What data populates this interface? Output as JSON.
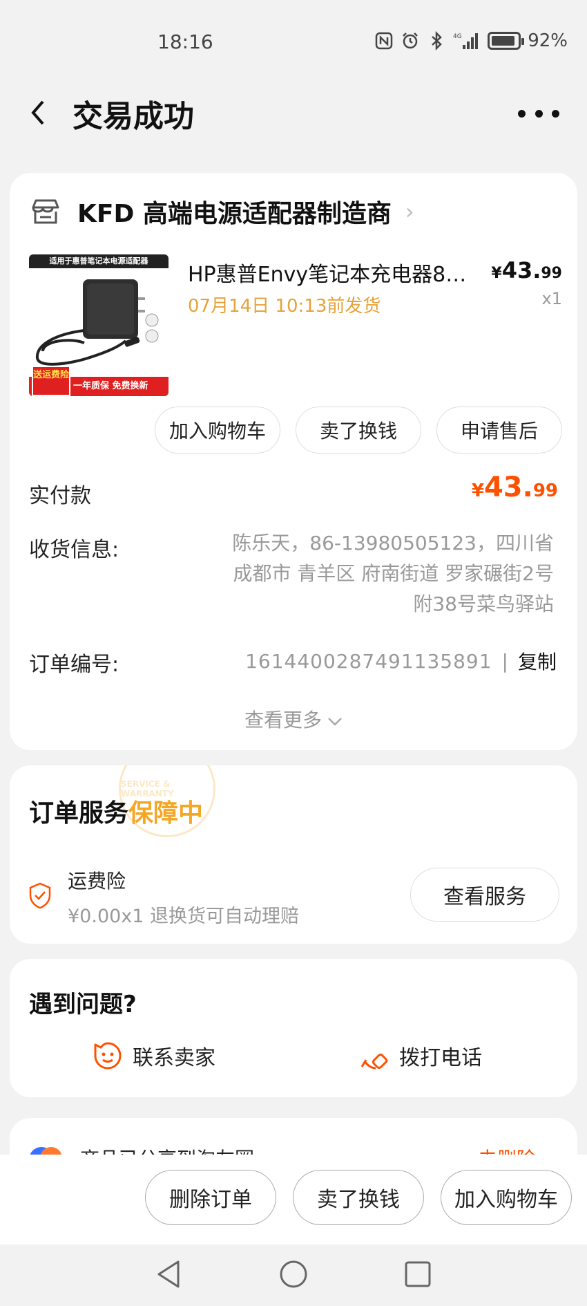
{
  "status": {
    "time": "18:16",
    "battery": "92%",
    "network": "4G"
  },
  "nav": {
    "title": "交易成功"
  },
  "shop": {
    "name": "KFD 高端电源适配器制造商"
  },
  "product": {
    "title": "HP惠普Envy笔记本充电器8…",
    "ship": "07月14日 10:13前发货",
    "price_currency": "¥",
    "price_int": "43.",
    "price_dec": "99",
    "qty": "x1",
    "image": {
      "banner": "适用于惠普笔记本电源适配器",
      "badge": "送运费险",
      "footer": "一年质保 免费换新"
    }
  },
  "actions": {
    "cart": "加入购物车",
    "sell": "卖了换钱",
    "after_sale": "申请售后"
  },
  "payment": {
    "label": "实付款",
    "currency": "¥",
    "int": "43.",
    "dec": "99"
  },
  "shipping": {
    "label": "收货信息:",
    "line1": "陈乐天，86-13980505123，四川省",
    "line2": "成都市 青羊区 府南街道 罗家碾街2号",
    "line3": "附38号菜鸟驿站"
  },
  "order": {
    "label": "订单编号:",
    "number": "1614400287491135891",
    "separator": "|",
    "copy": "复制"
  },
  "see_more": "查看更多",
  "service": {
    "title": "订单服务",
    "status": "保障中",
    "stamp_text": "SERVICE & WARRANTY",
    "name": "运费险",
    "desc": "¥0.00x1  退换货可自动理赔",
    "button": "查看服务"
  },
  "help": {
    "title": "遇到问题?",
    "contact": "联系卖家",
    "call": "拨打电话"
  },
  "share": {
    "text": "商品已分享到淘友圈",
    "action": "去删除"
  },
  "bottom": {
    "delete": "删除订单",
    "sell": "卖了换钱",
    "cart": "加入购物车"
  },
  "colors": {
    "accent": "#ff5000",
    "ship": "#e8a23a",
    "service": "#f5a623"
  }
}
